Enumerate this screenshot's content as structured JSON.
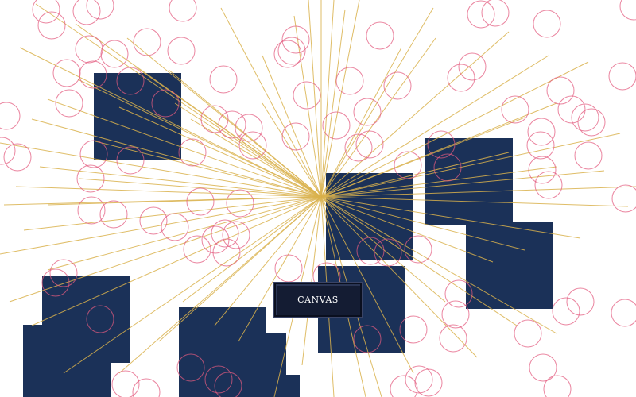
{
  "button": {
    "label": "CANVAS"
  },
  "colors": {
    "background": "#ffffff",
    "block": "#1b3158",
    "ray": "#d9b24c",
    "circle": "#e35b7f",
    "button": "#141c33"
  }
}
